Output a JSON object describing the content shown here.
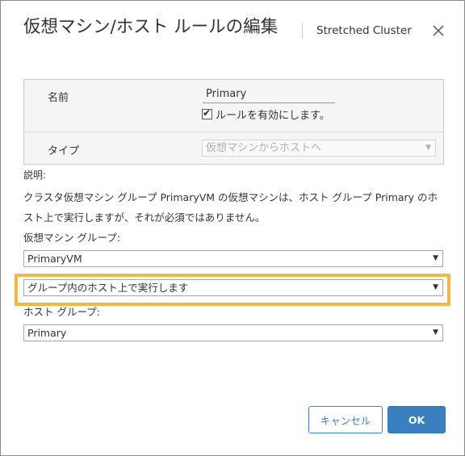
{
  "dialog": {
    "title": "仮想マシン/ホスト ルールの編集",
    "subtitle": "Stretched Cluster",
    "close_icon": "close-icon"
  },
  "form": {
    "name_label": "名前",
    "name_value": "Primary",
    "enable_checked": true,
    "enable_label": "ルールを有効にします。",
    "type_label": "タイプ",
    "type_value": "仮想マシンからホストへ"
  },
  "description": {
    "label": "説明:",
    "text": "クラスタ仮想マシン グループ PrimaryVM の仮想マシンは、ホスト グループ Primary のホスト上で実行しますが、それが必須ではありません。"
  },
  "vm_group": {
    "label": "仮想マシン グループ:",
    "value": "PrimaryVM"
  },
  "rule_mode": {
    "value": "グループ内のホスト上で実行します",
    "highlight_color": "#f0b940"
  },
  "host_group": {
    "label": "ホスト グループ:",
    "value": "Primary"
  },
  "buttons": {
    "cancel": "キャンセル",
    "ok": "OK"
  },
  "colors": {
    "accent": "#3a80c0"
  }
}
